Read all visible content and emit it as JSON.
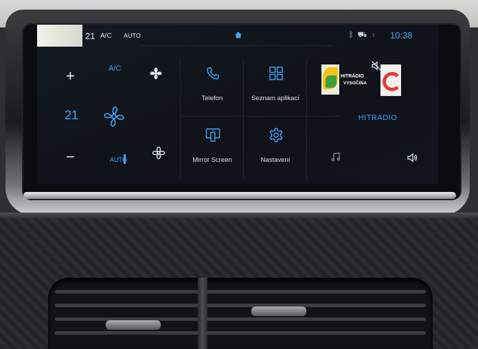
{
  "status_bar": {
    "temperature": "21",
    "ac": "A/C",
    "auto": "AUTO",
    "clock": "10:38"
  },
  "climate": {
    "ac_label": "A/C",
    "temperature": "21",
    "plus": "+",
    "minus": "−",
    "auto_label": "AUTO"
  },
  "apps": [
    {
      "label": "Telefon",
      "icon": "phone-icon"
    },
    {
      "label": "Seznam aplikací",
      "icon": "app-grid-icon"
    },
    {
      "label": "Mirror Screen",
      "icon": "mirror-screen-icon"
    },
    {
      "label": "Nastavení",
      "icon": "settings-icon"
    }
  ],
  "radio": {
    "logo_text_1": "HITRÁDIO",
    "logo_text_2": "VYSOČINA",
    "station": "HITRADIO"
  },
  "colors": {
    "accent": "#3fa7ff",
    "screen_bg": "#12161c",
    "text": "#dfe6ee"
  }
}
